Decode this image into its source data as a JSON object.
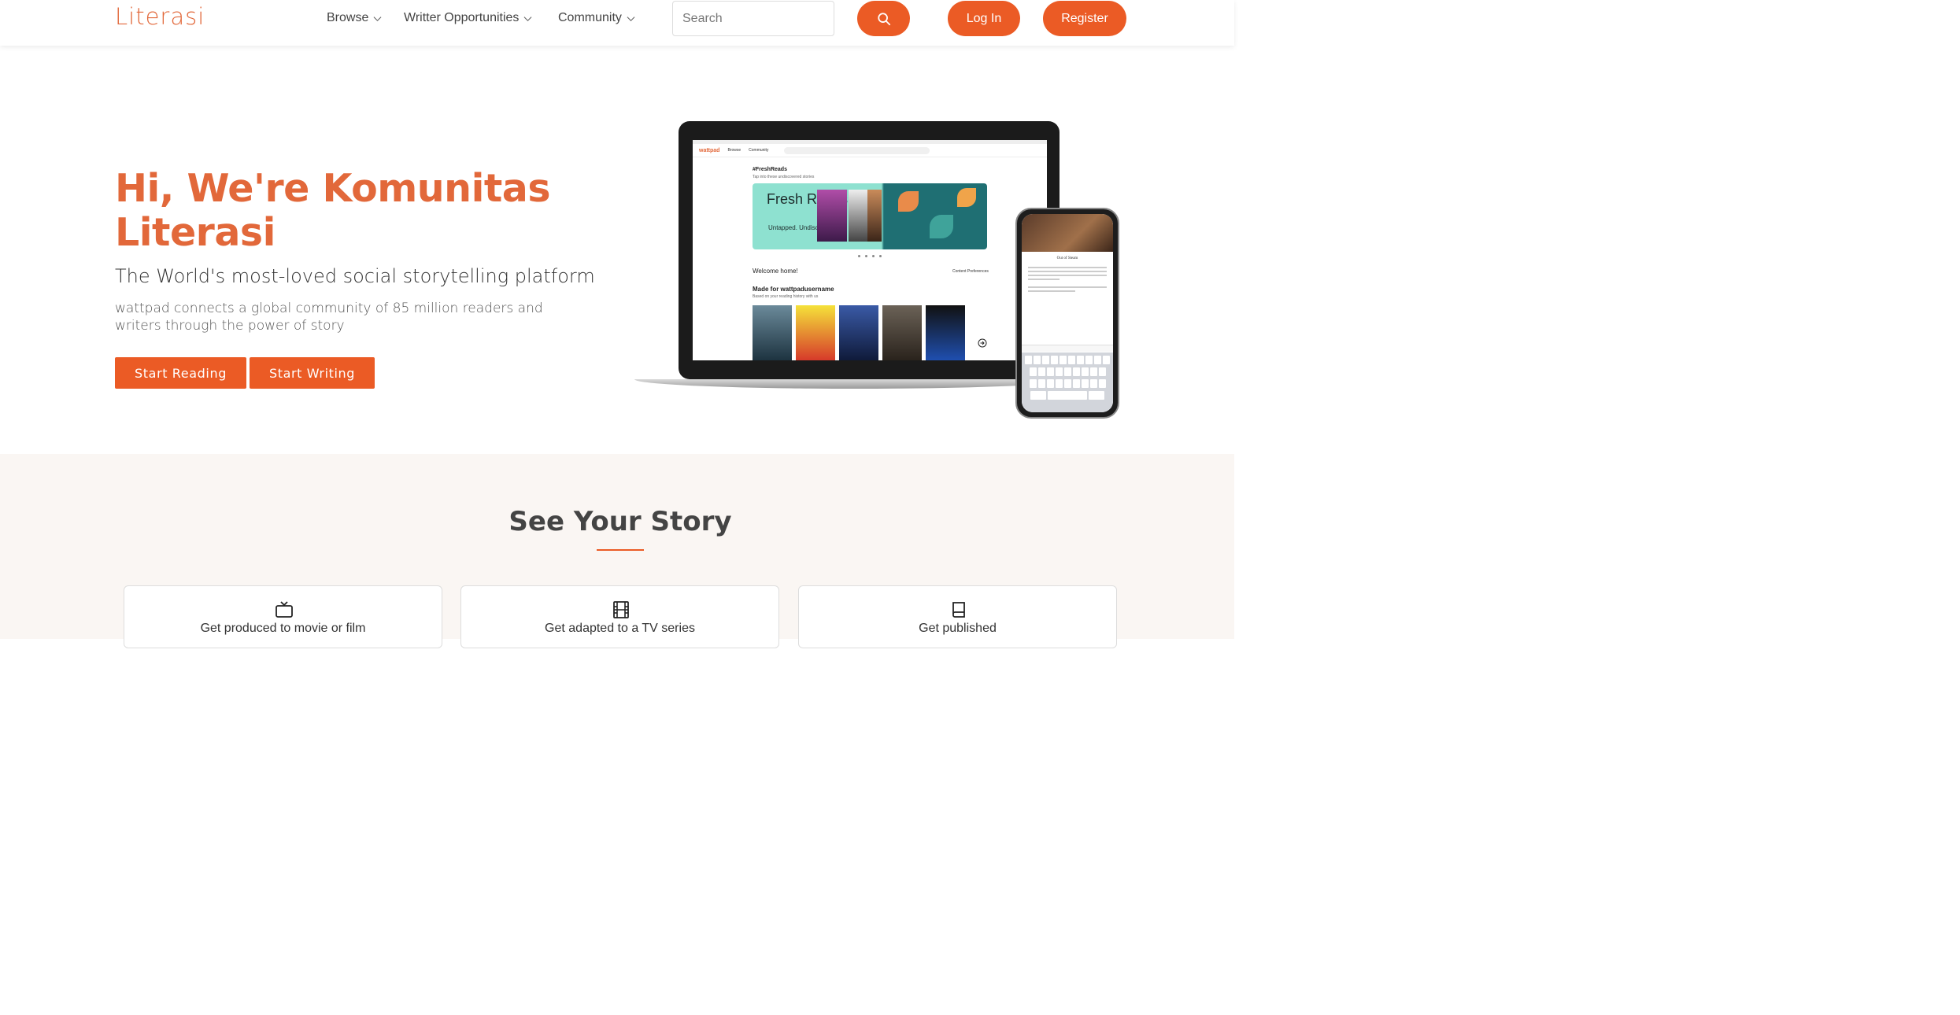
{
  "brand": "Literasi",
  "nav": {
    "items": [
      {
        "label": "Browse"
      },
      {
        "label": "Writter Opportunities"
      },
      {
        "label": "Community"
      }
    ],
    "search_placeholder": "Search",
    "login_label": "Log In",
    "register_label": "Register"
  },
  "hero": {
    "title": "Hi, We're Komunitas Literasi",
    "subtitle": "The World's most-loved social storytelling platform",
    "description": "wattpad connects a global community of 85 million readers and writers through the power of story",
    "start_reading_label": "Start Reading",
    "start_writing_label": "Start Writing"
  },
  "mockup": {
    "laptop_logo": "wattpad",
    "laptop_nav": [
      "Browse",
      "Community"
    ],
    "fresh_tag": "#FreshReads",
    "fresh_sub": "Tap into these undiscovered stories",
    "fresh_title": "Fresh Reads",
    "fresh_small": "Untapped. Undiscovered.",
    "welcome": "Welcome home!",
    "content_prefs": "Content Preferences",
    "made_for": "Made for wattpadusername",
    "made_for_sub": "Based on your reading history with us",
    "phone_title": "Out of Steam"
  },
  "story": {
    "title": "See Your Story",
    "cards": [
      {
        "label": "Get produced to movie or film",
        "icon": "tv-icon"
      },
      {
        "label": "Get adapted to a TV series",
        "icon": "film-icon"
      },
      {
        "label": "Get published",
        "icon": "book-icon"
      }
    ]
  },
  "colors": {
    "accent": "#eb5b25",
    "heading": "#e2683a",
    "section_bg": "#faf6f3"
  }
}
